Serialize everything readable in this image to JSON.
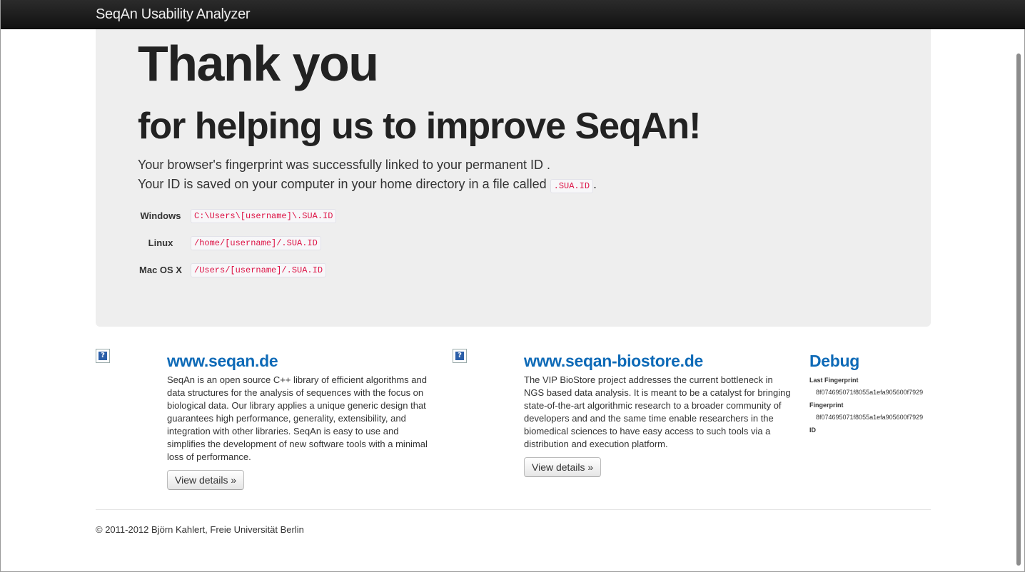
{
  "navbar": {
    "brand": "SeqAn Usability Analyzer"
  },
  "hero": {
    "title": "Thank you",
    "subtitle": "for helping us to improve SeqAn!",
    "line1": "Your browser's fingerprint was successfully linked to your permanent ID .",
    "line2_prefix": "Your ID is saved on your computer in your home directory in a file called ",
    "line2_code": ".SUA.ID",
    "line2_suffix": ".",
    "locations": [
      {
        "os": "Windows",
        "path": "C:\\Users\\[username]\\.SUA.ID"
      },
      {
        "os": "Linux",
        "path": "/home/[username]/.SUA.ID"
      },
      {
        "os": "Mac OS X",
        "path": "/Users/[username]/.SUA.ID"
      }
    ]
  },
  "columns": [
    {
      "title": "www.seqan.de",
      "text": "SeqAn is an open source C++ library of efficient algorithms and data structures for the analysis of sequences with the focus on biological data. Our library applies a unique generic design that guarantees high performance, generality, extensibility, and integration with other libraries. SeqAn is easy to use and simplifies the development of new software tools with a minimal loss of performance.",
      "button": "View details »"
    },
    {
      "title": "www.seqan-biostore.de",
      "text": "The VIP BioStore project addresses the current bottleneck in NGS based data analysis. It is meant to be a catalyst for bringing state-of-the-art algorithmic research to a broader community of developers and and the same time enable researchers in the biomedical sciences to have easy access to such tools via a distribution and execution platform.",
      "button": "View details »"
    }
  ],
  "debug": {
    "title": "Debug",
    "last_fingerprint_label": "Last Fingerprint",
    "last_fingerprint_value": "8f074695071f8055a1efa905600f7929",
    "fingerprint_label": "Fingerprint",
    "fingerprint_value": "8f074695071f8055a1efa905600f7929",
    "id_label": "ID"
  },
  "footer": {
    "text": "© 2011-2012 Björn Kahlert, Freie Universität Berlin"
  }
}
